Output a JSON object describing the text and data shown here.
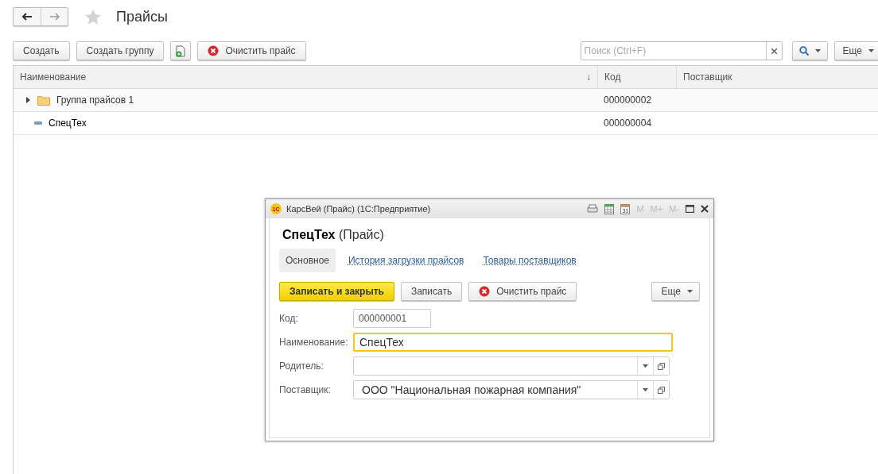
{
  "page": {
    "title": "Прайсы",
    "favorite": false
  },
  "toolbar": {
    "buttons": [
      {
        "kind": "text",
        "label": "Создать"
      },
      {
        "kind": "text",
        "label": "Создать группу"
      },
      {
        "kind": "icon"
      },
      {
        "kind": "clear",
        "label": "Очистить прайс"
      }
    ],
    "search": {
      "placeholder": "Поиск (Ctrl+F)"
    },
    "more": "Еще"
  },
  "table": {
    "columns": [
      "Наименование",
      "Код",
      "Поставщик"
    ],
    "sort_mark": "↓",
    "rows": [
      {
        "kind": "group",
        "expanded": false,
        "name": "Группа прайсов 1",
        "code": "000000002"
      },
      {
        "kind": "item",
        "name": "СпецТех",
        "code": "000000004"
      }
    ]
  },
  "dialog": {
    "badge": "1С",
    "title": "КарсВей (Прайс)  (1С:Предприятие)",
    "calendar_day": "31",
    "memory_buttons": [
      "M",
      "M+",
      "M-"
    ],
    "heading_name": "СпецТех",
    "heading_type": "(Прайс)",
    "tabs": [
      {
        "label": "Основное",
        "selected": true
      },
      {
        "label": "История загрузки прайсов",
        "selected": false
      },
      {
        "label": "Товары поставщиков",
        "selected": false
      }
    ],
    "buttons": [
      {
        "kind": "primary",
        "label": "Записать и закрыть"
      },
      {
        "kind": "text",
        "label": "Записать"
      },
      {
        "kind": "clear",
        "label": "Очистить прайс"
      }
    ],
    "more": "Еще",
    "fields": [
      {
        "kind": "plain",
        "label": "Код:",
        "value": "000000001",
        "focused": false
      },
      {
        "kind": "text",
        "label": "Наименование:",
        "value": "СпецТех",
        "focused": true
      },
      {
        "kind": "select",
        "label": "Родитель:",
        "focused": false
      },
      {
        "kind": "select",
        "label": "Поставщик:",
        "value": "ООО \"Национальная пожарная компания\"",
        "focused": false
      }
    ]
  }
}
